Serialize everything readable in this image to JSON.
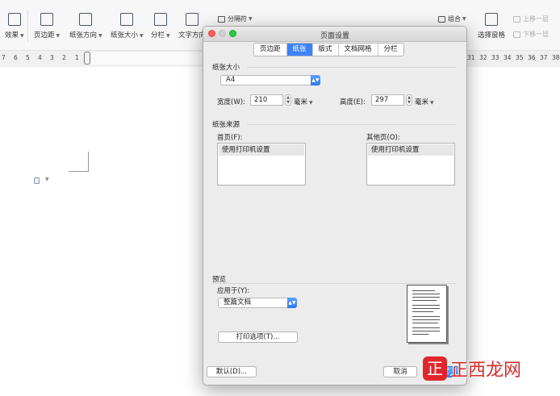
{
  "ribbon": {
    "effects": "效果",
    "margins": "页边距",
    "orientation": "纸张方向",
    "size": "纸张大小",
    "columns": "分栏",
    "text_direction": "文字方向",
    "breaks": "分隔符",
    "select_pane": "选择窗格",
    "group": "组合",
    "bring_forward": "上移一层",
    "send_backward": "下移一层"
  },
  "ruler": {
    "left_ticks": [
      "7",
      "6",
      "5",
      "4",
      "3",
      "2",
      "1"
    ],
    "right_ticks": [
      "31",
      "32",
      "33",
      "34",
      "35",
      "36",
      "37",
      "38"
    ]
  },
  "dialog": {
    "title": "页面设置",
    "tabs": [
      "页边距",
      "纸张",
      "版式",
      "文档网格",
      "分栏"
    ],
    "active_tab": "纸张",
    "paper_size": {
      "section_label": "纸张大小",
      "selected": "A4",
      "width_label": "宽度(W):",
      "width_value": "210",
      "width_unit": "毫米",
      "height_label": "高度(E):",
      "height_value": "297",
      "height_unit": "毫米"
    },
    "paper_source": {
      "section_label": "纸张来源",
      "first_page_label": "首页(F):",
      "first_page_item": "使用打印机设置",
      "other_pages_label": "其他页(O):",
      "other_pages_item": "使用打印机设置"
    },
    "preview": {
      "section_label": "预览",
      "apply_to_label": "应用于(Y):",
      "apply_to_value": "整篇文档",
      "print_options": "打印选项(T)..."
    },
    "buttons": {
      "default": "默认(D)...",
      "cancel": "取消",
      "ok": "确定"
    }
  },
  "watermark": {
    "text": "正西龙网"
  }
}
